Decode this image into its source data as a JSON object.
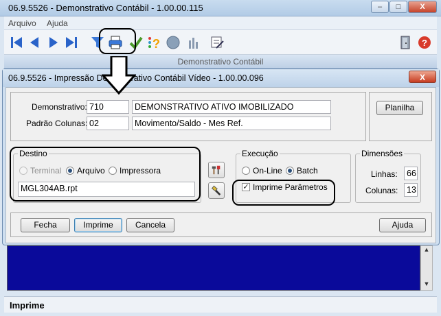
{
  "outer": {
    "title": "06.9.5526 - Demonstrativo Contábil - 1.00.00.115",
    "menu": [
      "Arquivo",
      "Ajuda"
    ],
    "band_title": "Demonstrativo Contábil",
    "status": "Imprime",
    "win_buttons": {
      "minimize": "–",
      "maximize": "□",
      "close": "X"
    }
  },
  "dialog": {
    "title": "06.9.5526 - Impressão Demonstrativo Contábil Vídeo - 1.00.00.096",
    "close": "X",
    "demonstrativo": {
      "label": "Demonstrativo:",
      "code": "710",
      "description": "DEMONSTRATIVO ATIVO IMOBILIZADO"
    },
    "padrao": {
      "label": "Padrão Colunas:",
      "code": "02",
      "description": "Movimento/Saldo - Mes Ref."
    },
    "planilha": "Planilha",
    "destino": {
      "title": "Destino",
      "terminal": "Terminal",
      "arquivo": "Arquivo",
      "impressora": "Impressora",
      "selected": "Arquivo",
      "file": "MGL304AB.rpt"
    },
    "execucao": {
      "title": "Execução",
      "online": "On-Line",
      "batch": "Batch",
      "selected": "Batch",
      "imprime_parametros": "Imprime Parâmetros",
      "imprime_checked": true
    },
    "dimensoes": {
      "title": "Dimensões",
      "linhas_label": "Linhas:",
      "linhas": "66",
      "colunas_label": "Colunas:",
      "colunas": "13"
    },
    "buttons": {
      "fecha": "Fecha",
      "imprime": "Imprime",
      "cancela": "Cancela",
      "ajuda": "Ajuda"
    }
  },
  "colors": {
    "accent": "#2a63c9",
    "dark_area": "#0a0a9a",
    "title_bar": "#bdd2e9"
  }
}
